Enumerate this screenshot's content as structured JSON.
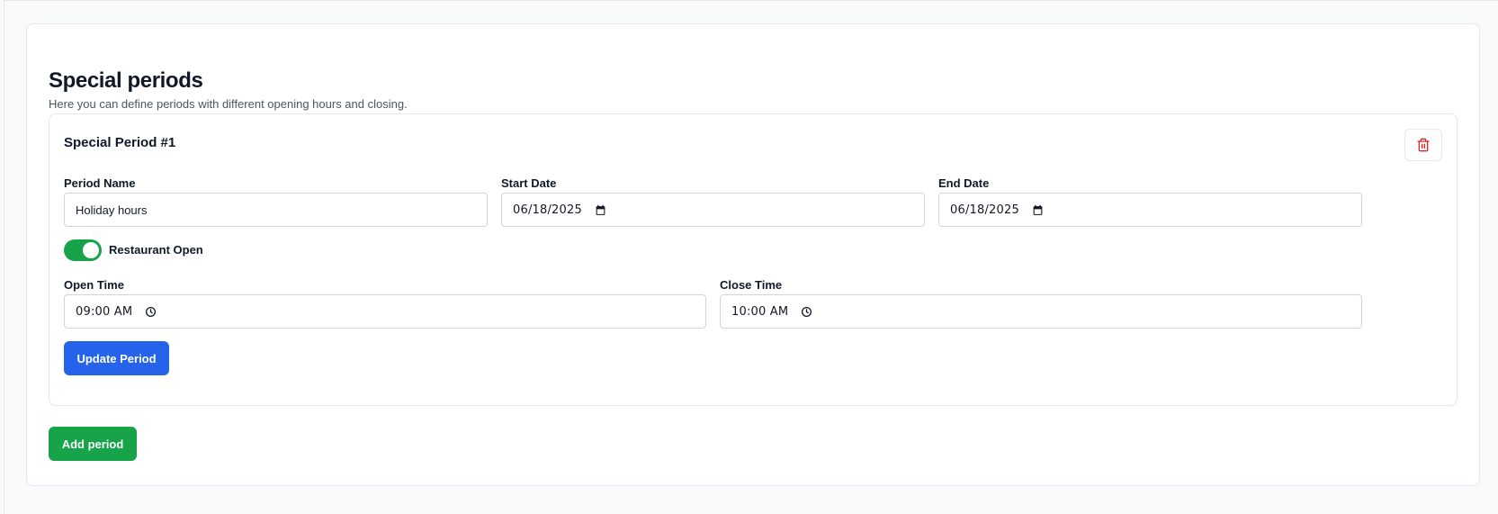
{
  "section": {
    "title": "Special periods",
    "subtitle": "Here you can define periods with different opening hours and closing."
  },
  "periods": [
    {
      "title": "Special Period #1",
      "fields": {
        "name_label": "Period Name",
        "name_value": "Holiday hours",
        "start_label": "Start Date",
        "start_value": "06/18/2025",
        "end_label": "End Date",
        "end_value": "06/18/2025",
        "open_toggle_label": "Restaurant Open",
        "open_toggle_on": true,
        "open_time_label": "Open Time",
        "open_time_value": "09:00 AM",
        "close_time_label": "Close Time",
        "close_time_value": "10:00 AM"
      },
      "update_label": "Update Period",
      "delete_icon": "trash-icon"
    }
  ],
  "add_label": "Add period",
  "colors": {
    "primary": "#2563eb",
    "success": "#16a34a",
    "danger": "#dc2626",
    "border": "#e5e7eb"
  }
}
